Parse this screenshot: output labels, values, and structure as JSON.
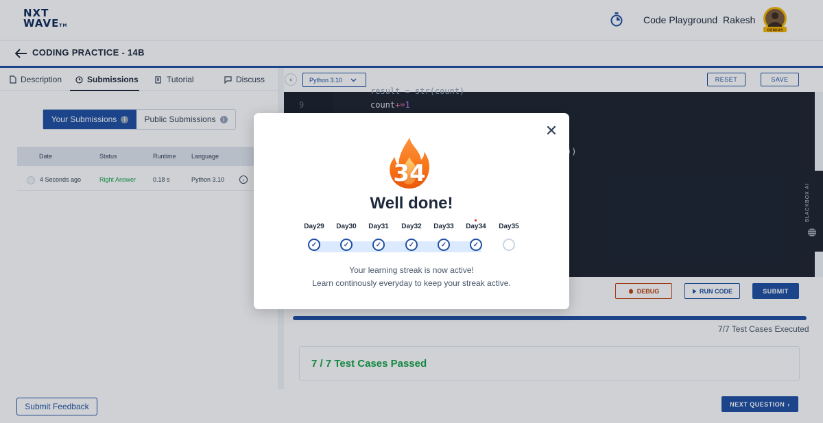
{
  "header": {
    "logo_line1": "NXT",
    "logo_line2": "WAVE",
    "logo_tm": "TM",
    "code_playground": "Code Playground",
    "user_name": "Rakesh",
    "avatar_badge": "GENIUS"
  },
  "page": {
    "title": "CODING PRACTICE - 14B"
  },
  "left_tabs": [
    {
      "label": "Description"
    },
    {
      "label": "Submissions"
    },
    {
      "label": "Tutorial"
    },
    {
      "label": "Discuss"
    }
  ],
  "submissions": {
    "your_label": "Your Submissions",
    "public_label": "Public Submissions",
    "columns": [
      "Date",
      "Status",
      "Runtime",
      "Language"
    ],
    "rows": [
      {
        "date": "4 Seconds ago",
        "status": "Right Answer",
        "runtime": "0.18 s",
        "language": "Python 3.10"
      }
    ]
  },
  "editor": {
    "language": "Python 3.10",
    "reset_label": "RESET",
    "save_label": "SAVE",
    "line_9": "9",
    "code_count": "count",
    "code_op": "+=",
    "code_num": "1",
    "code_partial_top": "result = str(count)",
    "code_parens": "))"
  },
  "side_tab": {
    "label": "BLACKBOX AI"
  },
  "actions": {
    "debug_label": "DEBUG",
    "run_label": "RUN CODE",
    "submit_label": "SUBMIT"
  },
  "results": {
    "progress": 1.0,
    "executed_text": "7/7 Test Cases Executed",
    "passed_text": "7 / 7 Test Cases Passed"
  },
  "footer": {
    "feedback_label": "Submit Feedback",
    "next_label": "NEXT QUESTION"
  },
  "modal": {
    "streak_count": "34",
    "heading": "Well done!",
    "days": [
      {
        "label": "Day29",
        "done": true
      },
      {
        "label": "Day30",
        "done": true
      },
      {
        "label": "Day31",
        "done": true
      },
      {
        "label": "Day32",
        "done": true
      },
      {
        "label": "Day33",
        "done": true
      },
      {
        "label": "Day34",
        "done": true
      },
      {
        "label": "Day35",
        "done": false
      }
    ],
    "message_line1": "Your learning streak is now active!",
    "message_line2": "Learn continously everyday to keep your streak active."
  },
  "colors": {
    "primary": "#1e4fa3",
    "success": "#16a34a",
    "debug": "#c2410c",
    "editor_bg": "#1e2530"
  }
}
